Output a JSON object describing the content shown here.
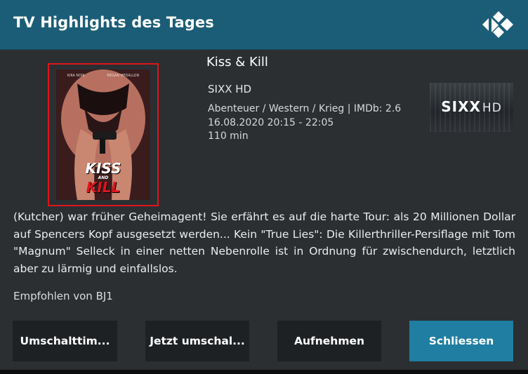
{
  "header": {
    "title": "TV Highlights des Tages"
  },
  "poster": {
    "credits": [
      "KIRA NOIR",
      "MEGAN MEDALLON"
    ],
    "title_line1": "KISS",
    "title_line2": "AND",
    "title_line3": "KILL"
  },
  "program": {
    "title": "Kiss & Kill",
    "channel": "SIXX HD",
    "genre_rating": "Abenteuer / Western / Krieg | IMDb: 2.6",
    "datetime": "16.08.2020 20:15 - 22:05",
    "duration": "110 min",
    "channel_logo_main": "SIXX",
    "channel_logo_hd": "HD"
  },
  "description": "(Kutcher) war früher Geheimagent! Sie erfährt es auf die harte Tour: als 20 Millionen Dollar auf Spencers Kopf ausgesetzt werden... Kein \"True Lies\": Die Killerthriller-Persiflage mit Tom \"Magnum\" Selleck in einer netten Nebenrolle ist in Ordnung für zwischendurch, letztlich aber zu lärmig und einfallslos.",
  "recommended": "Empfohlen von BJ1",
  "buttons": {
    "timer": "Umschalttim...",
    "switch_now": "Jetzt umschal...",
    "record": "Aufnehmen",
    "close": "Schliessen"
  },
  "colors": {
    "header": "#1b5d76",
    "focused_button": "#1f7ea1",
    "highlight_border": "#e0141c"
  }
}
